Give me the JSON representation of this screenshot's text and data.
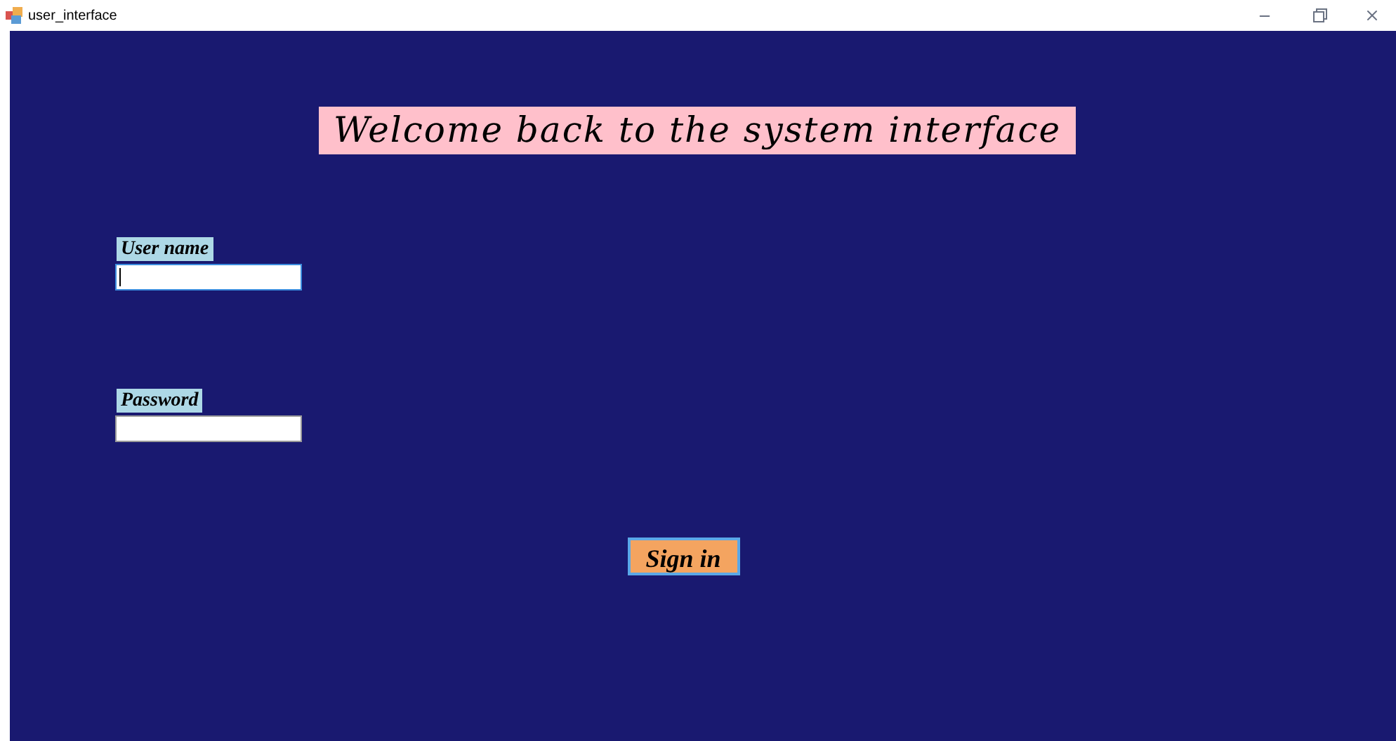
{
  "window": {
    "title": "user_interface"
  },
  "heading": "Welcome back to the system interface",
  "fields": [
    {
      "label": "User name",
      "focused": true
    },
    {
      "label": "Password",
      "focused": false
    }
  ],
  "buttons": [
    "Sign in"
  ]
}
